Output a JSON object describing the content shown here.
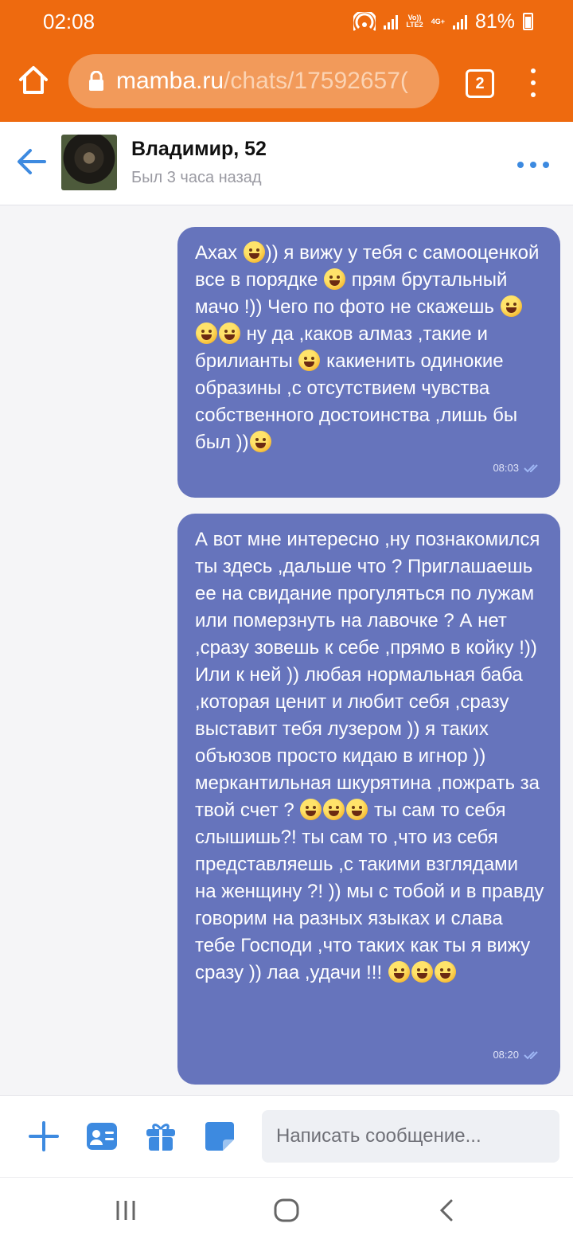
{
  "status_bar": {
    "time": "02:08",
    "network_label_top": "Vo))",
    "network_label_bottom": "LTE2",
    "network_type": "4G+",
    "battery": "81%",
    "icons": [
      "hotspot-icon",
      "signal-icon",
      "battery-icon"
    ]
  },
  "browser": {
    "url_host": "mamba.ru",
    "url_path": "/chats/17592657(",
    "tab_count": "2",
    "accent_color": "#ee6a0f"
  },
  "chat_header": {
    "name": "Владимир, 52",
    "last_seen": "Был 3 часа назад"
  },
  "messages": [
    {
      "parts": [
        "Ахах ",
        "emoji",
        ")) я вижу у тебя с самооценкой все в порядке ",
        "emoji",
        " прям брутальный мачо !)) Чего по фото не скажешь ",
        "emoji",
        "emoji",
        "emoji",
        " ну да ,каков алмаз ,такие и брилианты ",
        "emoji",
        " какиенить одинокие образины ,с отсутствием чувства собственного достоинства ,лишь бы был ))",
        "emoji"
      ],
      "time": "08:03"
    },
    {
      "parts": [
        "А вот мне интересно ,ну познакомился ты здесь ,дальше что ? Приглашаешь ее на свидание прогуляться по лужам или померзнуть на лавочке ? А нет ,сразу зовешь к себе ,прямо в койку !)) Или к ней )) любая нормальная баба ,которая ценит и любит себя ,сразу выставит тебя лузером )) я таких объюзов просто кидаю в игнор )) меркантильная шкурятина ,пожрать за твой счет ? ",
        "emoji",
        "emoji",
        "emoji",
        " ты сам то себя слышишь?! ты сам то ,что из себя представляешь ,с такими взглядами на женщину ?! )) мы с тобой и в правду говорим на разных языках и слава тебе Господи ,что таких как ты я вижу сразу )) лаа ,удачи !!! ",
        "emoji",
        "emoji",
        "emoji"
      ],
      "time": "08:20"
    }
  ],
  "composer": {
    "placeholder": "Написать сообщение...",
    "icons": [
      "plus-icon",
      "contact-card-icon",
      "gift-icon",
      "sticker-icon"
    ]
  },
  "colors": {
    "bubble": "#6674bc",
    "link_blue": "#3d8ae0"
  }
}
